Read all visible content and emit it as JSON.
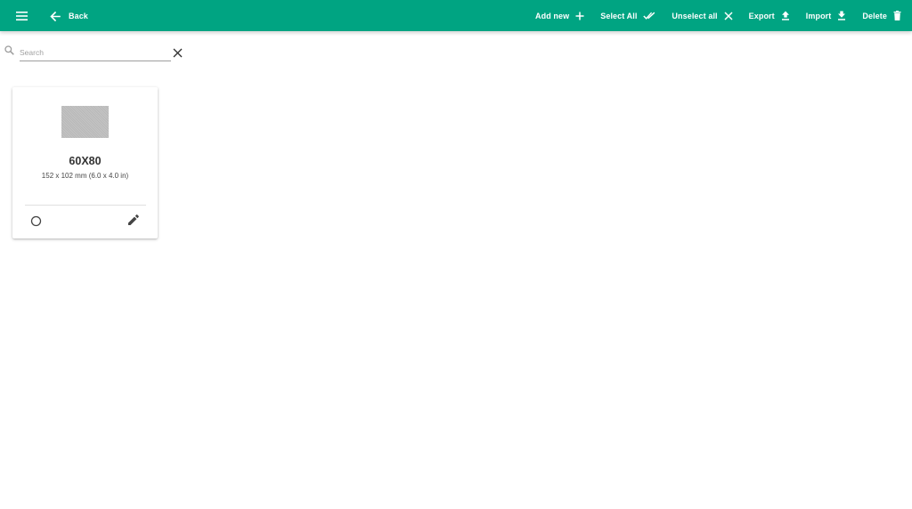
{
  "toolbar": {
    "back_label": "Back",
    "actions": {
      "add_new": "Add new",
      "select_all": "Select All",
      "unselect_all": "Unselect all",
      "export": "Export",
      "import": "Import",
      "delete": "Delete"
    },
    "icons": [
      "menu-icon",
      "arrow-back-icon",
      "plus-icon",
      "double-check-icon",
      "close-icon",
      "upload-icon",
      "download-icon",
      "trash-icon"
    ]
  },
  "search": {
    "placeholder": "Search",
    "value": ""
  },
  "cards": [
    {
      "title": "60X80",
      "subtitle": "152 x 102 mm (6.0 x 4.0 in)"
    }
  ],
  "colors": {
    "primary": "#00a482",
    "toolbar_text": "#ffffff",
    "thumbnail": "#bdbdbd"
  }
}
